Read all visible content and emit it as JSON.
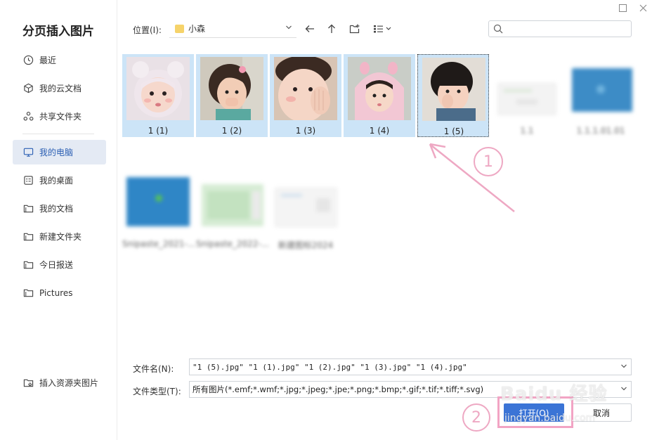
{
  "dialog": {
    "title": "分页插入图片"
  },
  "window_controls": {
    "maximize_icon": "square-icon",
    "close_icon": "close-icon"
  },
  "sidebar": {
    "items": [
      {
        "label": "最近",
        "icon": "clock-icon"
      },
      {
        "label": "我的云文档",
        "icon": "cloud-doc-icon"
      },
      {
        "label": "共享文件夹",
        "icon": "share-icon"
      },
      {
        "label": "我的电脑",
        "icon": "computer-icon",
        "active": true
      },
      {
        "label": "我的桌面",
        "icon": "desktop-icon"
      },
      {
        "label": "我的文档",
        "icon": "folder-icon"
      },
      {
        "label": "新建文件夹",
        "icon": "folder-icon"
      },
      {
        "label": "今日报送",
        "icon": "folder-icon"
      },
      {
        "label": "Pictures",
        "icon": "folder-icon"
      }
    ],
    "bottom_item": {
      "label": "插入资源夹图片",
      "icon": "star-folder-icon"
    }
  },
  "toolbar": {
    "location_label": "位置(I):",
    "location_value": "小森",
    "search_placeholder": ""
  },
  "files": [
    {
      "name": "1 (1)",
      "selected": true
    },
    {
      "name": "1 (2)",
      "selected": true
    },
    {
      "name": "1 (3)",
      "selected": true
    },
    {
      "name": "1 (4)",
      "selected": true
    },
    {
      "name": "1 (5)",
      "selected": true,
      "focused": true
    },
    {
      "name": "1.1",
      "blurred": true
    },
    {
      "name": "1.1.1.01.01",
      "blurred": true
    },
    {
      "name": "Snipaste_2021-...",
      "blurred": true
    },
    {
      "name": "Snipaste_2022-...",
      "blurred": true
    },
    {
      "name": "新建图标2024",
      "blurred": true
    }
  ],
  "footer": {
    "filename_label": "文件名(N):",
    "filename_value": "\"1 (5).jpg\" \"1 (1).jpg\" \"1 (2).jpg\" \"1 (3).jpg\" \"1 (4).jpg\"",
    "filetype_label": "文件类型(T):",
    "filetype_value": "所有图片(*.emf;*.wmf;*.jpg;*.jpeg;*.jpe;*.png;*.bmp;*.gif;*.tif;*.tiff;*.svg)",
    "open_label": "打开(O)",
    "cancel_label": "取消"
  },
  "annotations": {
    "step1": "1",
    "step2": "2",
    "color": "#eea8c3"
  },
  "watermark": {
    "text": "Baidu 经验",
    "sub": "jingyan.baidu.com"
  },
  "colors": {
    "accent": "#3b74d6",
    "selection": "#cce4f7",
    "sidebar_active": "#e4eaf4"
  }
}
